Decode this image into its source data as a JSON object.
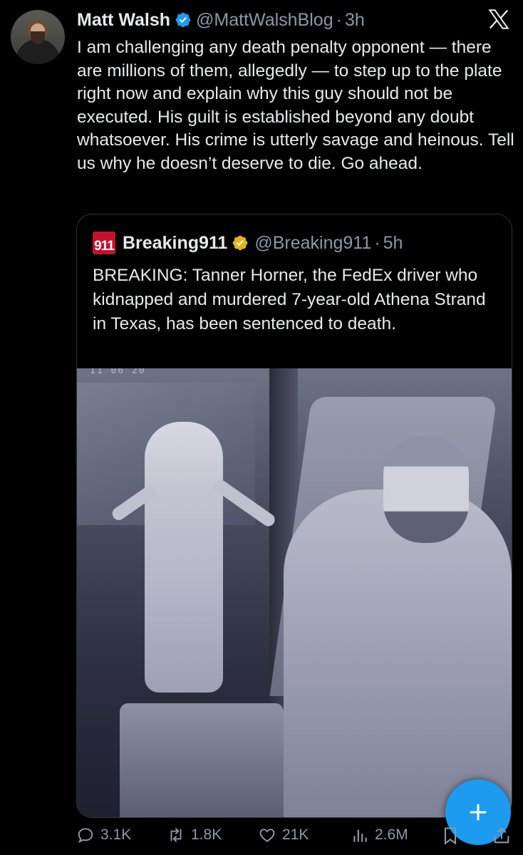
{
  "tweet": {
    "author_name": "Matt Walsh",
    "handle": "@MattWalshBlog",
    "separator": "·",
    "time": "3h",
    "text": "I am challenging any death penalty opponent — there are millions of them, allegedly — to step up to the plate right now and explain why this guy should not be executed. His guilt is established beyond any doubt whatsoever. His crime is utterly savage and heinous. Tell us why he doesn’t deserve to die. Go ahead."
  },
  "quote": {
    "logo_top": "BREAKING",
    "logo_number": "911",
    "author_name": "Breaking911",
    "handle": "@Breaking911",
    "separator": "·",
    "time": "5h",
    "text": "BREAKING: Tanner Horner, the FedEx driver who kidnapped and murdered 7-year-old Athena Strand in Texas, has been sentenced to death.",
    "media_overlay_text": "11  06  20"
  },
  "actions": {
    "replies": "3.1K",
    "reposts": "1.8K",
    "likes": "21K",
    "views": "2.6M"
  },
  "icons": {
    "verified": "verified-badge-icon",
    "gold_check": "gold-verified-icon",
    "platform": "x-logo-icon",
    "compose": "plus-icon"
  },
  "colors": {
    "background": "#000000",
    "text": "#e7e9ea",
    "secondary": "#8b98a5",
    "accent": "#1d9bf0",
    "gold": "#e2b719",
    "border": "#2f3336"
  }
}
